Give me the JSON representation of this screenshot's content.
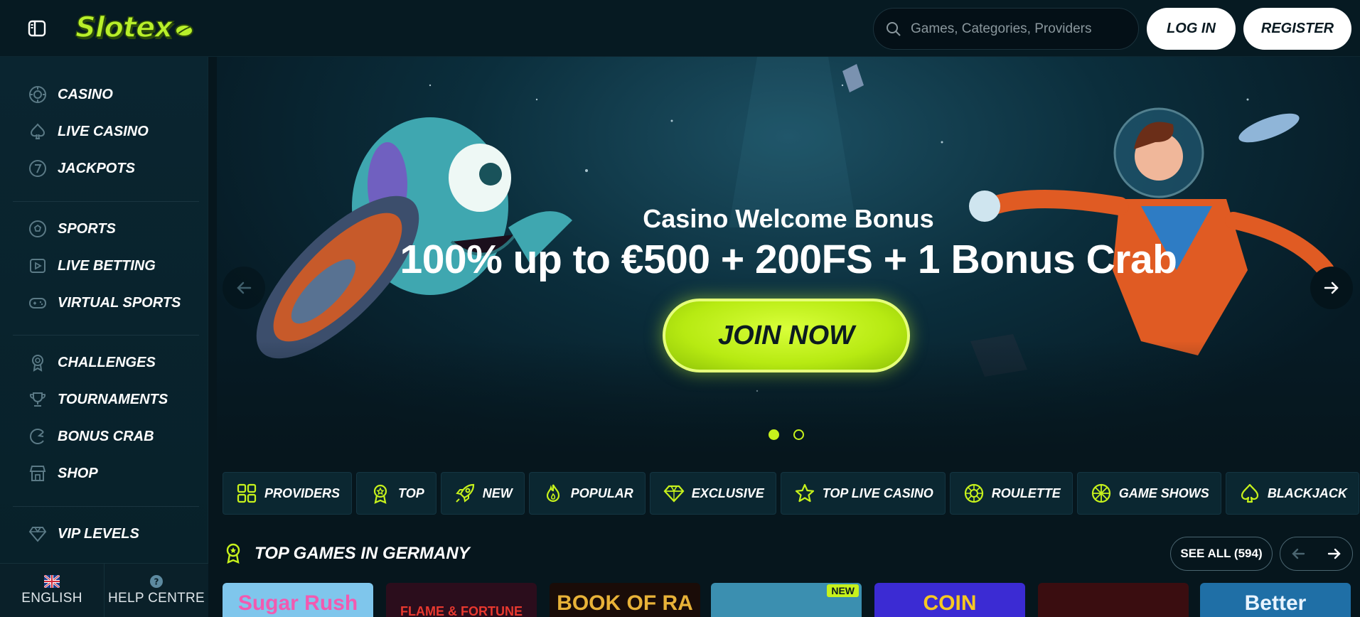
{
  "brand": {
    "logo_text": "Slotex",
    "accent": "#c7f21c",
    "background": "#06161d"
  },
  "header": {
    "search_placeholder": "Games, Categories, Providers",
    "login_label": "LOG IN",
    "register_label": "REGISTER"
  },
  "sidebar": {
    "groups": [
      [
        {
          "label": "CASINO",
          "icon": "casino-chip-icon"
        },
        {
          "label": "LIVE CASINO",
          "icon": "spade-icon"
        },
        {
          "label": "JACKPOTS",
          "icon": "seven-icon"
        }
      ],
      [
        {
          "label": "SPORTS",
          "icon": "soccer-ball-icon"
        },
        {
          "label": "LIVE BETTING",
          "icon": "play-icon"
        },
        {
          "label": "VIRTUAL SPORTS",
          "icon": "gamepad-icon"
        }
      ],
      [
        {
          "label": "CHALLENGES",
          "icon": "medal-icon"
        },
        {
          "label": "TOURNAMENTS",
          "icon": "trophy-icon"
        },
        {
          "label": "BONUS CRAB",
          "icon": "crab-icon"
        },
        {
          "label": "SHOP",
          "icon": "shop-icon"
        }
      ],
      [
        {
          "label": "VIP LEVELS",
          "icon": "diamond-icon"
        }
      ]
    ],
    "footer": {
      "language": "ENGLISH",
      "help": "HELP CENTRE"
    }
  },
  "banner": {
    "subtitle": "Casino Welcome Bonus",
    "title": "100% up to €500 + 200FS + 1 Bonus Crab",
    "cta": "JOIN NOW",
    "slides": 2,
    "active_slide": 1
  },
  "categories": [
    {
      "label": "PROVIDERS",
      "icon": "grid-icon"
    },
    {
      "label": "TOP",
      "icon": "award-icon"
    },
    {
      "label": "NEW",
      "icon": "rocket-icon"
    },
    {
      "label": "POPULAR",
      "icon": "flame-icon"
    },
    {
      "label": "EXCLUSIVE",
      "icon": "diamond-icon"
    },
    {
      "label": "TOP LIVE CASINO",
      "icon": "star-icon"
    },
    {
      "label": "ROULETTE",
      "icon": "roulette-icon"
    },
    {
      "label": "GAME SHOWS",
      "icon": "wheel-icon"
    },
    {
      "label": "BLACKJACK",
      "icon": "spade-icon"
    }
  ],
  "top_games": {
    "title": "TOP GAMES IN GERMANY",
    "see_all": "SEE ALL (594)",
    "tiles": [
      {
        "title": "Sugar Rush",
        "bg": "#7fc6ec",
        "color": "#f25ab0"
      },
      {
        "title": "FLAME & FORTUNE",
        "bg": "#2b0d1c",
        "color": "#e8382f"
      },
      {
        "title": "BOOK OF RA",
        "bg": "#1a0c08",
        "color": "#e8b238"
      },
      {
        "title": "",
        "bg": "#3b8fb0",
        "color": "#ffffff",
        "badge": "NEW"
      },
      {
        "title": "COIN",
        "bg": "#3b2bd3",
        "color": "#f7c822"
      },
      {
        "title": "",
        "bg": "#3a0d10",
        "color": "#ffffff"
      },
      {
        "title": "Better",
        "bg": "#1f6fa6",
        "color": "#e9f4ff"
      }
    ]
  }
}
